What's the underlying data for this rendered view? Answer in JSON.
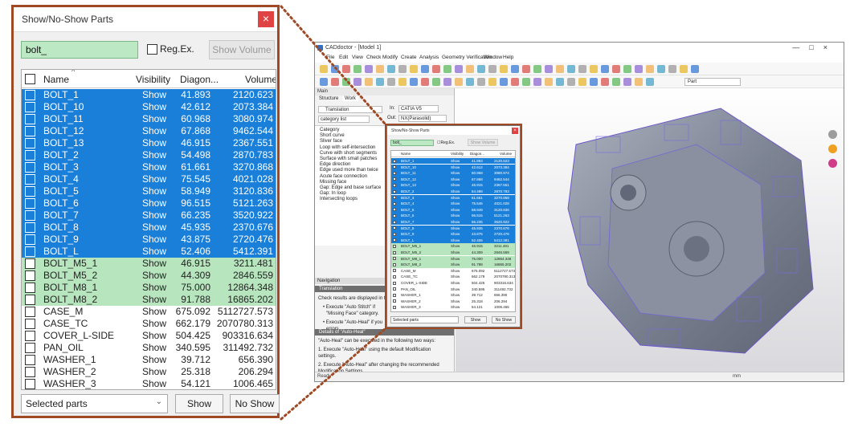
{
  "dialog": {
    "title": "Show/No-Show Parts",
    "close_glyph": "×",
    "search_value": "bolt_",
    "regex_label": "Reg.Ex.",
    "show_volume_label": "Show Volume",
    "columns": [
      "Name",
      "Visibility",
      "Diagon...",
      "Volume"
    ],
    "rows": [
      {
        "name": "BOLT_1",
        "vis": "Show",
        "diag": "41.893",
        "vol": "2120.623",
        "style": "blue"
      },
      {
        "name": "BOLT_10",
        "vis": "Show",
        "diag": "42.612",
        "vol": "2073.384",
        "style": "blue"
      },
      {
        "name": "BOLT_11",
        "vis": "Show",
        "diag": "60.968",
        "vol": "3080.974",
        "style": "blue"
      },
      {
        "name": "BOLT_12",
        "vis": "Show",
        "diag": "67.868",
        "vol": "9462.544",
        "style": "blue"
      },
      {
        "name": "BOLT_13",
        "vis": "Show",
        "diag": "46.915",
        "vol": "2367.551",
        "style": "blue"
      },
      {
        "name": "BOLT_2",
        "vis": "Show",
        "diag": "54.498",
        "vol": "2870.783",
        "style": "blue"
      },
      {
        "name": "BOLT_3",
        "vis": "Show",
        "diag": "61.661",
        "vol": "3270.868",
        "style": "blue"
      },
      {
        "name": "BOLT_4",
        "vis": "Show",
        "diag": "75.545",
        "vol": "4021.028",
        "style": "blue"
      },
      {
        "name": "BOLT_5",
        "vis": "Show",
        "diag": "58.949",
        "vol": "3120.836",
        "style": "blue"
      },
      {
        "name": "BOLT_6",
        "vis": "Show",
        "diag": "96.515",
        "vol": "5121.263",
        "style": "blue"
      },
      {
        "name": "BOLT_7",
        "vis": "Show",
        "diag": "66.235",
        "vol": "3520.922",
        "style": "blue"
      },
      {
        "name": "BOLT_8",
        "vis": "Show",
        "diag": "45.935",
        "vol": "2370.676",
        "style": "blue"
      },
      {
        "name": "BOLT_9",
        "vis": "Show",
        "diag": "43.875",
        "vol": "2720.476",
        "style": "blue"
      },
      {
        "name": "BOLT_L",
        "vis": "Show",
        "diag": "52.406",
        "vol": "5412.391",
        "style": "blue"
      },
      {
        "name": "BOLT_M5_1",
        "vis": "Show",
        "diag": "46.915",
        "vol": "3211.481",
        "style": "green"
      },
      {
        "name": "BOLT_M5_2",
        "vis": "Show",
        "diag": "44.309",
        "vol": "2846.559",
        "style": "green"
      },
      {
        "name": "BOLT_M8_1",
        "vis": "Show",
        "diag": "75.000",
        "vol": "12864.348",
        "style": "green"
      },
      {
        "name": "BOLT_M8_2",
        "vis": "Show",
        "diag": "91.788",
        "vol": "16865.202",
        "style": "green"
      },
      {
        "name": "CASE_M",
        "vis": "Show",
        "diag": "675.092",
        "vol": "5112727.573",
        "style": "white"
      },
      {
        "name": "CASE_TC",
        "vis": "Show",
        "diag": "662.179",
        "vol": "2070780.313",
        "style": "white"
      },
      {
        "name": "COVER_L-SIDE",
        "vis": "Show",
        "diag": "504.425",
        "vol": "903316.634",
        "style": "white"
      },
      {
        "name": "PAN_OIL",
        "vis": "Show",
        "diag": "340.595",
        "vol": "311492.732",
        "style": "white"
      },
      {
        "name": "WASHER_1",
        "vis": "Show",
        "diag": "39.712",
        "vol": "656.390",
        "style": "white"
      },
      {
        "name": "WASHER_2",
        "vis": "Show",
        "diag": "25.318",
        "vol": "206.294",
        "style": "white"
      },
      {
        "name": "WASHER_3",
        "vis": "Show",
        "diag": "54.121",
        "vol": "1006.465",
        "style": "white"
      }
    ],
    "scope_select": "Selected parts",
    "show_label": "Show",
    "noshow_label": "No Show"
  },
  "app": {
    "title": "CADdoctor - [Model 1]",
    "menus": [
      "File",
      "Edit",
      "View",
      "Check",
      "Modify",
      "Create",
      "Analysis",
      "Geometry Verification",
      "Window",
      "Help"
    ],
    "tabs": [
      "Structure",
      "Work"
    ],
    "translation_label": "Translation",
    "category_label": "category list",
    "in_label": "In:",
    "in_value": "CATIA V5",
    "out_label": "Out:",
    "out_value": "NX(Parasolid)",
    "part_label": "Part",
    "main_label": "Main",
    "check_items": [
      "Category",
      "Short curve",
      "Sliver face",
      "Loop with self-intersection",
      "Curve with short segments",
      "Surface with small patches",
      "Edge direction",
      "Edge used more than twice",
      "Acute face connection",
      "Missing face",
      "Gap: Edge and base surface",
      "Gap: In loop",
      "Intersecting loops"
    ],
    "nav_label": "Navigation",
    "translation_section": "Translation",
    "nav_text": "Check results are displayed in the",
    "bullet1a": "Execute \"",
    "bullet1b": "Auto Stitch\" if",
    "bullet1c": "\"Missing Face\" category.",
    "bullet2a": "Execute \"",
    "bullet2b": "Auto-Heal\" if you",
    "bullet2c": "errors",
    "autoheal_header": "Details of \"Auto-Heal\"",
    "autoheal_text": "\"Auto-Heal\" can be executed in the following two ways:",
    "step1": "1.  Execute \"Auto-Heal\" using the default Modification settings.",
    "step2": "2.  Execute \"Auto-Heal\" after changing the recommended Modification Settings",
    "status_left": "Ready",
    "status_right": "mm"
  },
  "mini_dialog": {
    "title": "Show/No-Show Parts",
    "search_value": "bolt_",
    "regex_label": "Reg.Ex.",
    "show_volume_label": "Show Volume",
    "columns": [
      "Name",
      "Visibility",
      "Diagon...",
      "Volume"
    ],
    "scope_select": "Selected parts",
    "show_label": "Show",
    "noshow_label": "No Show"
  },
  "colors": {
    "frame": "#a04a25",
    "selection_blue": "#1a7fd8",
    "highlight_green": "#b7e6be",
    "close_red": "#e04343"
  }
}
